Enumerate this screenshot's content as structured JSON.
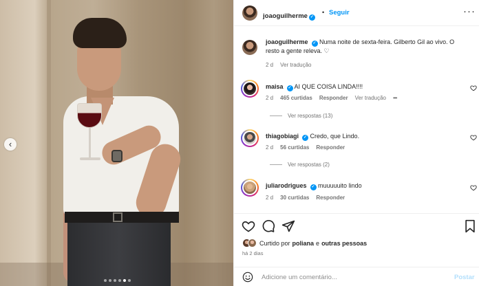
{
  "post_image": {
    "alt": "",
    "carousel_dots": 6,
    "active_dot": 4
  },
  "header": {
    "username": "joaoguilherme",
    "separator": "•",
    "follow_label": "Seguir",
    "more_icon": "more-horizontal-icon"
  },
  "caption": {
    "username": "joaoguilherme",
    "text": "Numa noite de sexta-feira. Gilberto Gil ao vivo. O resto a gente releva. ♡",
    "age": "2 d",
    "translate": "Ver tradução"
  },
  "comments": [
    {
      "username": "maisa",
      "verified": true,
      "text": "AI QUE COISA LINDA!!!!",
      "age": "2 d",
      "likes": "465 curtidas",
      "reply": "Responder",
      "translate": "Ver tradução",
      "more": "•••",
      "view_replies": "Ver respostas (13)"
    },
    {
      "username": "thiagobiagi",
      "verified": true,
      "text": "Credo, que Lindo.",
      "age": "2 d",
      "likes": "56 curtidas",
      "reply": "Responder",
      "view_replies": "Ver respostas (2)"
    },
    {
      "username": "juliarodrigues",
      "verified": true,
      "text": "muuuuuito lindo",
      "age": "2 d",
      "likes": "30 curtidas",
      "reply": "Responder"
    }
  ],
  "liked_by": {
    "prefix": "Curtido por",
    "user": "poliana",
    "conj": "e",
    "others": "outras pessoas"
  },
  "post_date": "há 2 dias",
  "composer": {
    "placeholder": "Adicione um comentário...",
    "post_label": "Postar"
  },
  "colors": {
    "accent": "#0095f6",
    "text": "#262626",
    "muted": "#737373",
    "post_disabled": "#b2dffc"
  }
}
